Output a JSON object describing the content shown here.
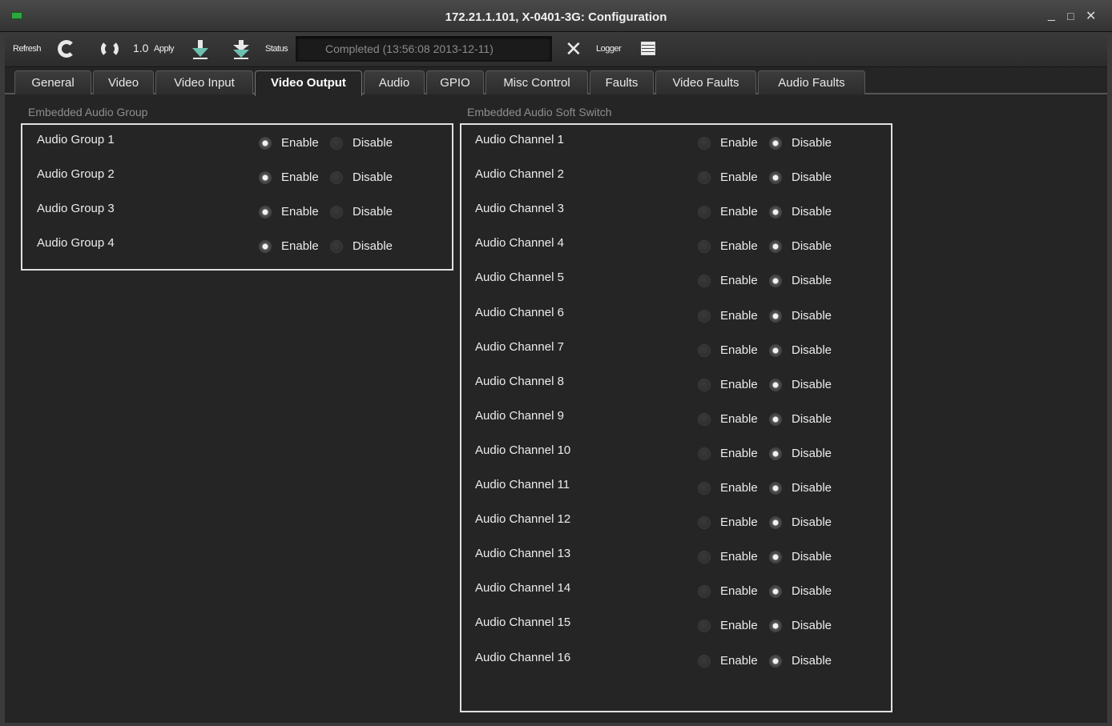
{
  "window": {
    "title": "172.21.1.101, X-0401-3G: Configuration",
    "minimize": "_",
    "maximize": "□",
    "close": "✕"
  },
  "toolbar": {
    "refresh_label": "Refresh",
    "version_label": "1.0",
    "apply_label": "Apply",
    "status_label": "Status",
    "status_value": "Completed  (13:56:08  2013-12-11)",
    "logger_label": "Logger"
  },
  "tabs": [
    {
      "label": "General"
    },
    {
      "label": "Video"
    },
    {
      "label": "Video Input"
    },
    {
      "label": "Video Output"
    },
    {
      "label": "Audio"
    },
    {
      "label": "GPIO"
    },
    {
      "label": "Misc Control"
    },
    {
      "label": "Faults"
    },
    {
      "label": "Video Faults"
    },
    {
      "label": "Audio Faults"
    }
  ],
  "active_tab": "Video Output",
  "embedded_audio_group": {
    "title": "Embedded Audio Group",
    "enable_label": "Enable",
    "disable_label": "Disable",
    "rows": [
      {
        "label": "Audio Group 1",
        "value": "Enable"
      },
      {
        "label": "Audio Group 2",
        "value": "Enable"
      },
      {
        "label": "Audio Group 3",
        "value": "Enable"
      },
      {
        "label": "Audio Group 4",
        "value": "Enable"
      }
    ]
  },
  "embedded_audio_soft_switch": {
    "title": "Embedded Audio Soft Switch",
    "enable_label": "Enable",
    "disable_label": "Disable",
    "rows": [
      {
        "label": "Audio Channel 1",
        "value": "Disable"
      },
      {
        "label": "Audio Channel 2",
        "value": "Disable"
      },
      {
        "label": "Audio Channel 3",
        "value": "Disable"
      },
      {
        "label": "Audio Channel 4",
        "value": "Disable"
      },
      {
        "label": "Audio Channel 5",
        "value": "Disable"
      },
      {
        "label": "Audio Channel 6",
        "value": "Disable"
      },
      {
        "label": "Audio Channel 7",
        "value": "Disable"
      },
      {
        "label": "Audio Channel 8",
        "value": "Disable"
      },
      {
        "label": "Audio Channel 9",
        "value": "Disable"
      },
      {
        "label": "Audio Channel 10",
        "value": "Disable"
      },
      {
        "label": "Audio Channel 11",
        "value": "Disable"
      },
      {
        "label": "Audio Channel 12",
        "value": "Disable"
      },
      {
        "label": "Audio Channel 13",
        "value": "Disable"
      },
      {
        "label": "Audio Channel 14",
        "value": "Disable"
      },
      {
        "label": "Audio Channel 15",
        "value": "Disable"
      },
      {
        "label": "Audio Channel 16",
        "value": "Disable"
      }
    ]
  },
  "colors": {
    "background": "#252525",
    "panel_border": "#e0e0e0",
    "app_icon": "#2fa640"
  }
}
